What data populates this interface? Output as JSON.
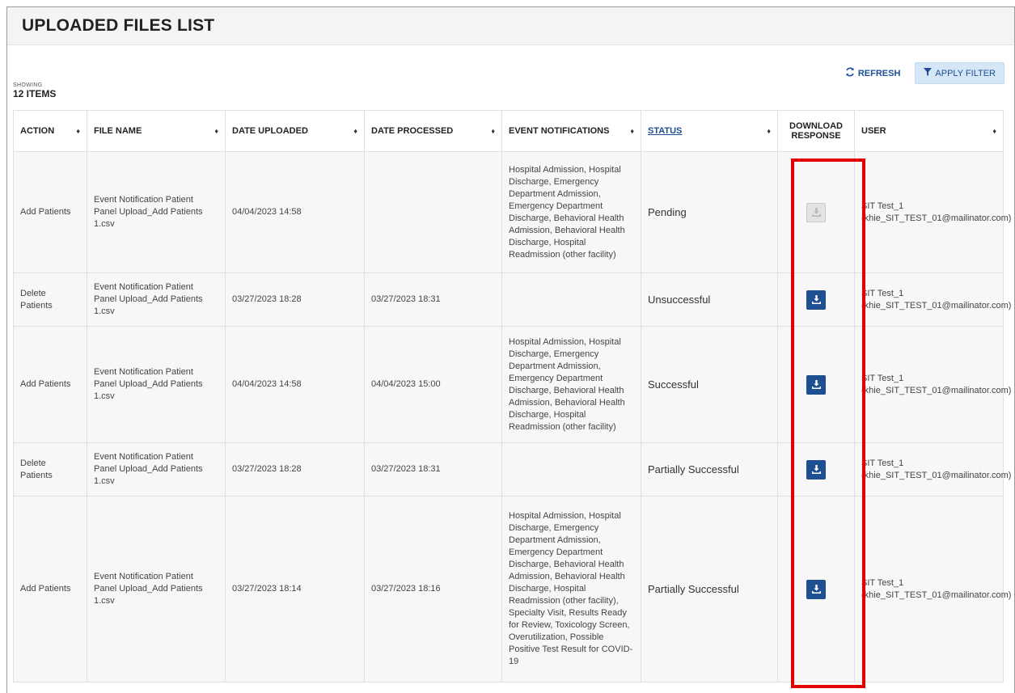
{
  "title": "UPLOADED FILES LIST",
  "toolbar": {
    "refresh_label": "REFRESH",
    "filter_label": "APPLY FILTER"
  },
  "showing": {
    "label": "SHOWING",
    "count": "12 ITEMS"
  },
  "columns": {
    "action": "ACTION",
    "file_name": "FILE NAME",
    "date_uploaded": "DATE UPLOADED",
    "date_processed": "DATE PROCESSED",
    "event_notifications": "EVENT NOTIFICATIONS",
    "status": "STATUS",
    "download_line1": "DOWNLOAD",
    "download_line2": "RESPONSE",
    "user": "USER"
  },
  "rows": [
    {
      "action": "Add Patients",
      "file_name": "Event Notification Patient Panel Upload_Add Patients 1.csv",
      "date_uploaded": "04/04/2023 14:58",
      "date_processed": "",
      "event_notifications": "Hospital Admission, Hospital Discharge, Emergency Department Admission, Emergency Department Discharge, Behavioral Health Admission, Behavioral Health Discharge, Hospital Readmission (other facility)",
      "status": "Pending",
      "download_enabled": false,
      "user": "SIT Test_1 (khie_SIT_TEST_01@mailinator.com)"
    },
    {
      "action": "Delete Patients",
      "file_name": "Event Notification Patient Panel Upload_Add Patients 1.csv",
      "date_uploaded": "03/27/2023 18:28",
      "date_processed": "03/27/2023 18:31",
      "event_notifications": "",
      "status": "Unsuccessful",
      "download_enabled": true,
      "user": "SIT Test_1 (khie_SIT_TEST_01@mailinator.com)"
    },
    {
      "action": "Add Patients",
      "file_name": "Event Notification Patient Panel Upload_Add Patients 1.csv",
      "date_uploaded": "04/04/2023 14:58",
      "date_processed": "04/04/2023 15:00",
      "event_notifications": "Hospital Admission, Hospital Discharge, Emergency Department Admission, Emergency Department Discharge, Behavioral Health Admission, Behavioral Health Discharge, Hospital Readmission (other facility)",
      "status": "Successful",
      "download_enabled": true,
      "user": "SIT Test_1 (khie_SIT_TEST_01@mailinator.com)"
    },
    {
      "action": "Delete Patients",
      "file_name": "Event Notification Patient Panel Upload_Add Patients 1.csv",
      "date_uploaded": "03/27/2023 18:28",
      "date_processed": "03/27/2023 18:31",
      "event_notifications": "",
      "status": "Partially Successful",
      "download_enabled": true,
      "user": "SIT Test_1 (khie_SIT_TEST_01@mailinator.com)"
    },
    {
      "action": "Add Patients",
      "file_name": "Event Notification Patient Panel Upload_Add Patients 1.csv",
      "date_uploaded": "03/27/2023 18:14",
      "date_processed": "03/27/2023 18:16",
      "event_notifications": "Hospital Admission, Hospital Discharge, Emergency Department Admission, Emergency Department Discharge, Behavioral Health Admission, Behavioral Health Discharge, Hospital Readmission (other facility), Specialty Visit, Results Ready for Review, Toxicology Screen, Overutilization, Possible Positive Test Result for COVID-19",
      "status": "Partially Successful",
      "download_enabled": true,
      "user": "SIT Test_1 (khie_SIT_TEST_01@mailinator.com)"
    }
  ],
  "colors": {
    "accent": "#1d4f91",
    "highlight": "#e30000",
    "disabled": "#e3e3e3"
  }
}
